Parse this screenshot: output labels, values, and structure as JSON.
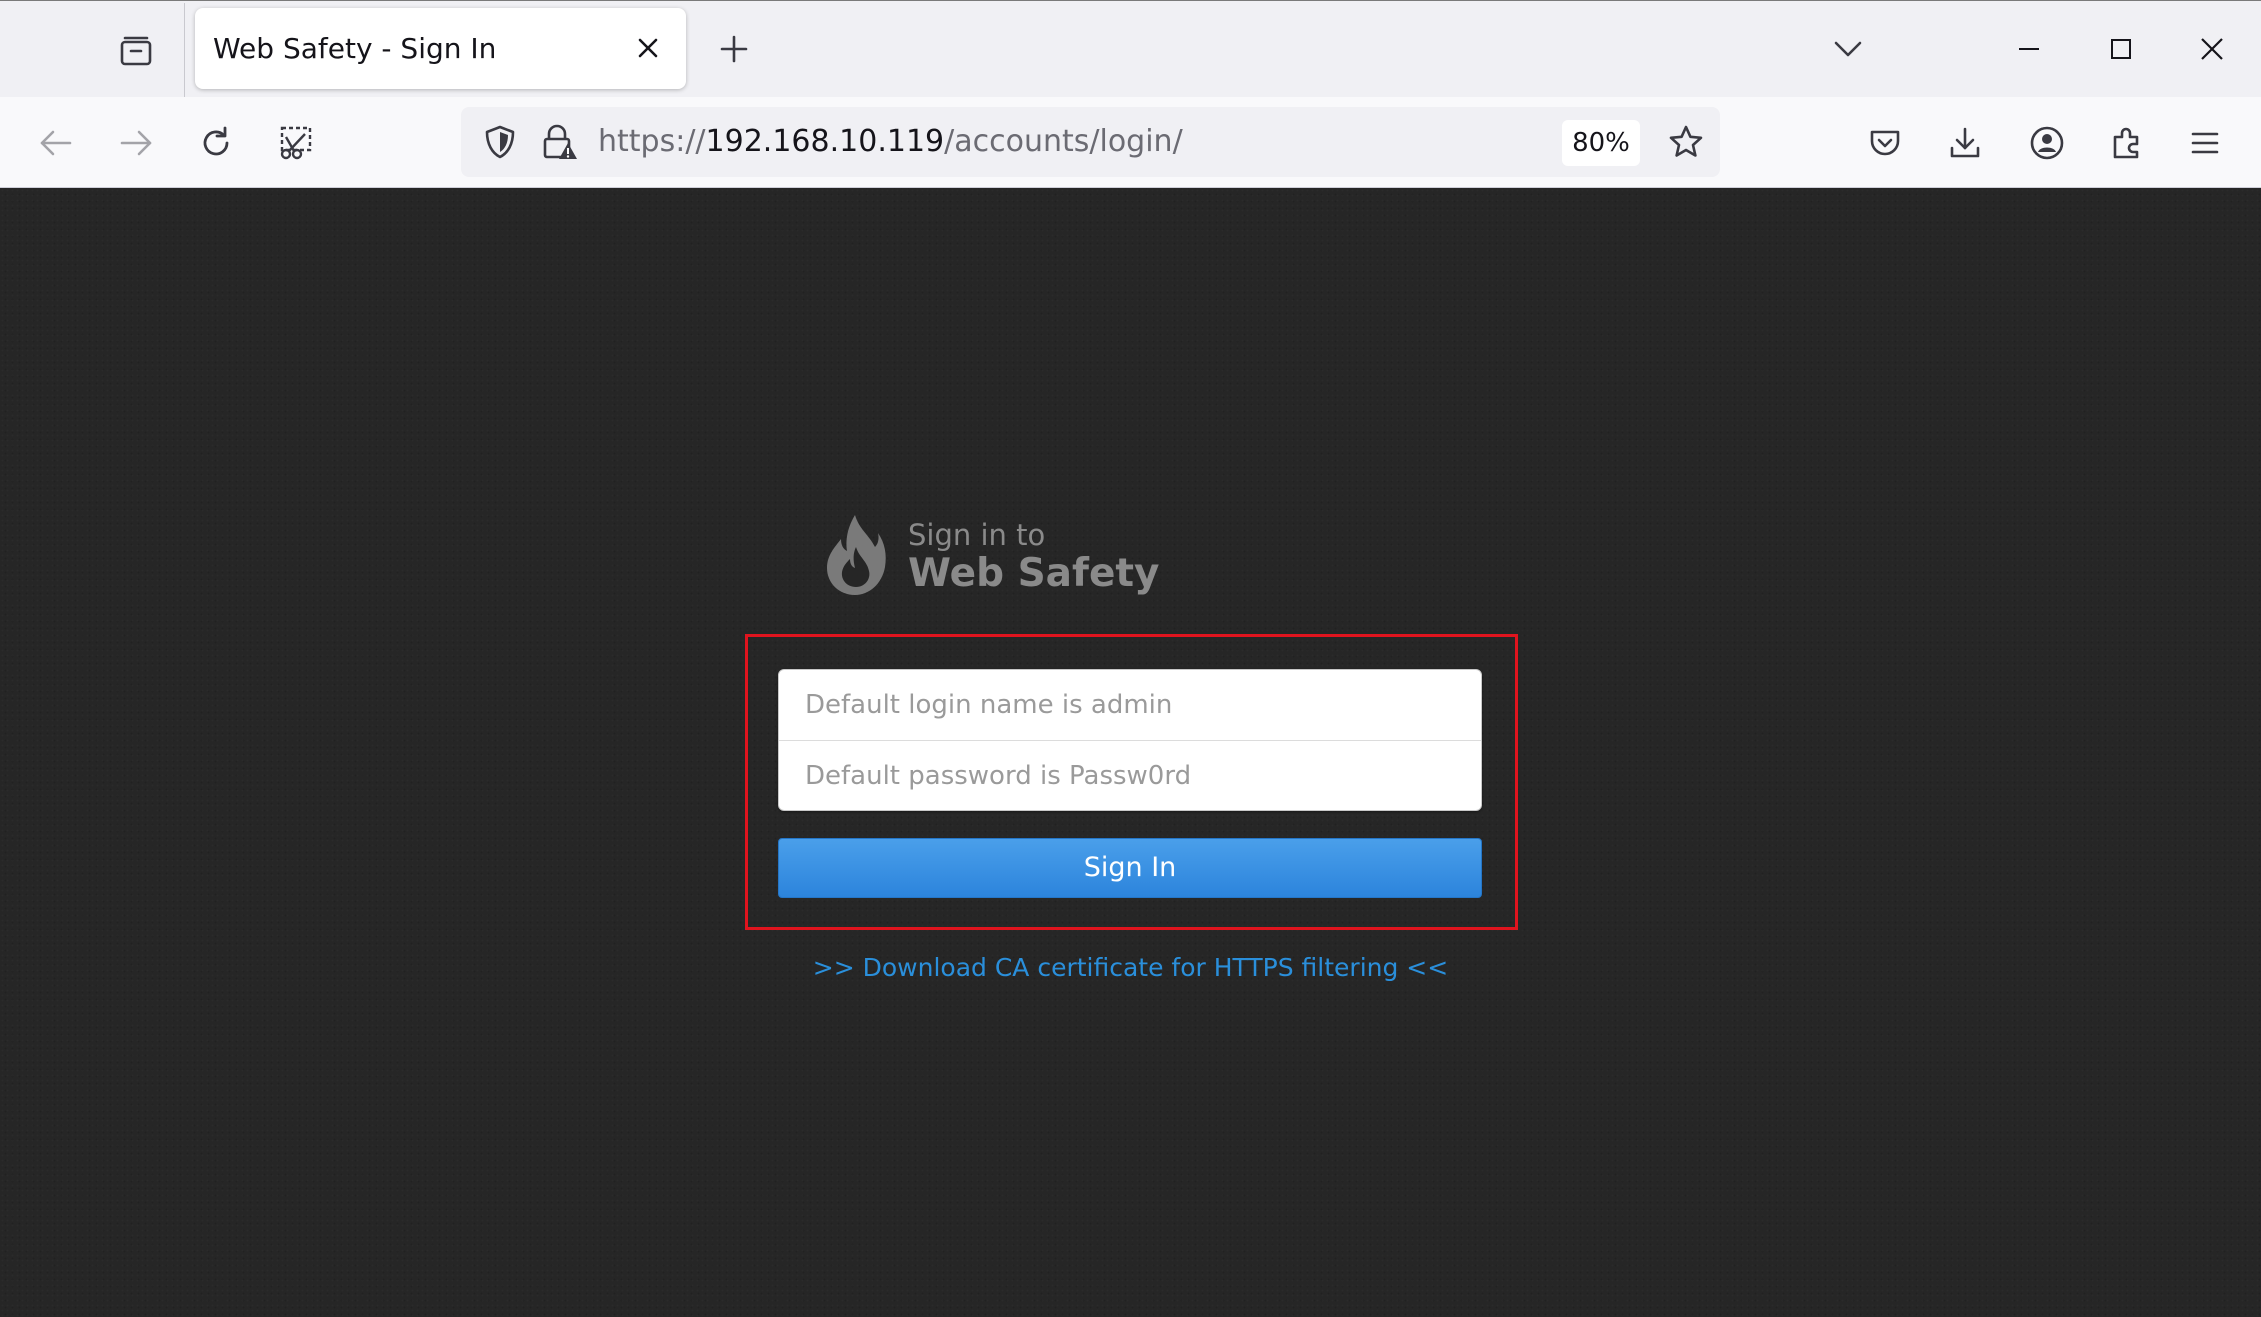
{
  "browser": {
    "tab": {
      "title": "Web Safety - Sign In",
      "close_icon": "close-icon"
    },
    "icons": {
      "tab_list": "tab-list-icon",
      "new_tab": "plus-icon",
      "list_all_tabs": "chevron-down-icon",
      "minimize": "minimize-icon",
      "maximize": "maximize-icon",
      "close": "close-icon"
    },
    "url": {
      "scheme": "https://",
      "host": "192.168.10.119",
      "path": "/accounts/login/",
      "zoom": "80%"
    }
  },
  "login": {
    "brand_pre": "Sign in to",
    "brand_name": "Web Safety",
    "username_placeholder": "Default login name is admin",
    "password_placeholder": "Default password is Passw0rd",
    "submit_label": "Sign In",
    "ca_link": ">> Download CA certificate for HTTPS filtering <<"
  },
  "colors": {
    "page_bg": "#262626",
    "button_blue": "#2c84dc",
    "link_blue": "#2a8fdb",
    "highlight_red": "#e0141e"
  }
}
